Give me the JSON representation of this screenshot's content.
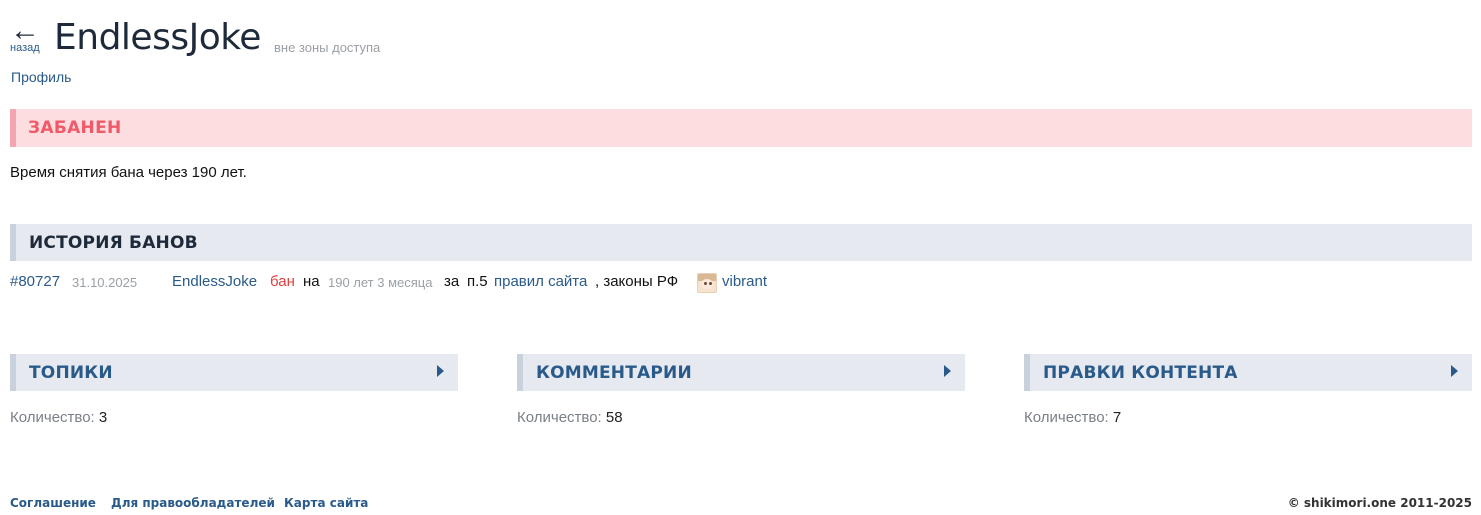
{
  "header": {
    "back_arrow": "←",
    "back_label": "назад",
    "username": "EndlessJoke",
    "status": "вне зоны доступа"
  },
  "nav": {
    "profile_link": "Профиль"
  },
  "ban_notice": {
    "heading": "ЗАБАНЕН",
    "text": "Время снятия бана через 190 лет."
  },
  "ban_history": {
    "heading": "ИСТОРИЯ БАНОВ",
    "entries": [
      {
        "id": "#80727",
        "date": "31.10.2025",
        "user": "EndlessJoke",
        "action": "бан",
        "on_word": "на",
        "duration": "190 лет 3 месяца",
        "reason_prefix": "за",
        "rule_ref": "п.5",
        "rules_link": "правил сайта",
        "reason_suffix": ", законы РФ",
        "moderator": "vibrant"
      }
    ]
  },
  "columns": [
    {
      "title": "ТОПИКИ",
      "count_label": "Количество:",
      "count": "3"
    },
    {
      "title": "КОММЕНТАРИИ",
      "count_label": "Количество:",
      "count": "58"
    },
    {
      "title": "ПРАВКИ КОНТЕНТА",
      "count_label": "Количество:",
      "count": "7"
    }
  ],
  "footer": {
    "links": [
      "Соглашение",
      "Для правообладателей",
      "Карта сайта"
    ],
    "copyright": "© shikimori.one 2011-2025"
  },
  "colors": {
    "link": "#2a5a8a",
    "ban_red": "#f05a68",
    "ban_bg": "#fddde0",
    "section_bg": "#e6eaf0"
  }
}
